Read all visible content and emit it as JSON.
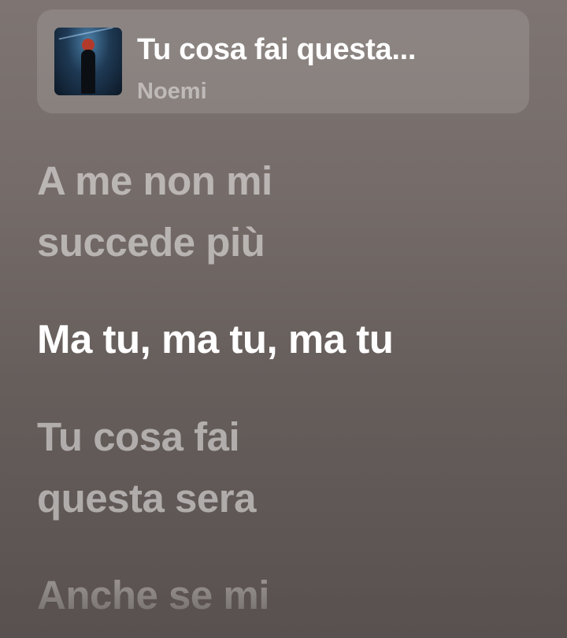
{
  "now_playing": {
    "title": "Tu cosa fai questa...",
    "artist": "Noemi"
  },
  "lyrics": [
    {
      "lines": [
        "A me non mi",
        "succede più"
      ],
      "state": "past"
    },
    {
      "lines": [
        "Ma tu, ma tu, ma tu"
      ],
      "state": "active"
    },
    {
      "lines": [
        "Tu cosa fai",
        "questa sera"
      ],
      "state": "upcoming"
    },
    {
      "lines": [
        "Anche se mi"
      ],
      "state": "upcoming-faded"
    }
  ],
  "colors": {
    "active_text": "#ffffff",
    "inactive_text": "rgba(255,255,255,0.5)",
    "background_top": "#7e7572",
    "background_bottom": "#595150"
  },
  "icons": {
    "album_art": "album-art"
  }
}
